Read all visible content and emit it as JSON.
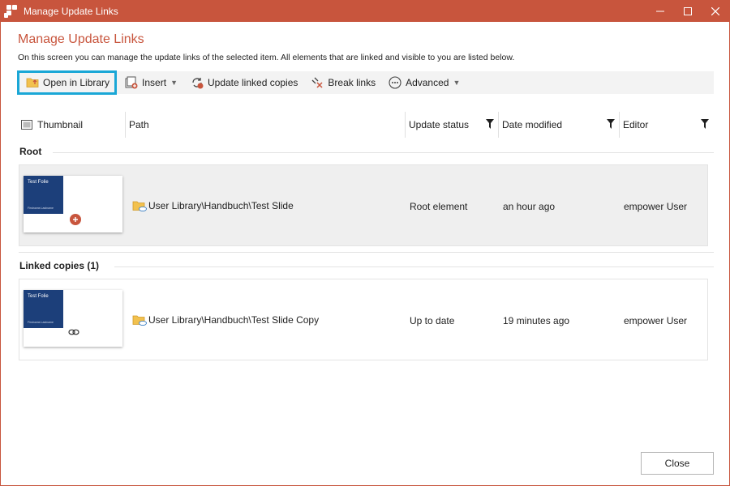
{
  "window": {
    "title": "Manage Update Links",
    "controls": {
      "minimize": "—",
      "maximize": "☐",
      "close": "✕"
    }
  },
  "header": {
    "title": "Manage Update Links",
    "description": "On this screen you can manage the update links of the selected item. All elements that are linked and visible to you are listed below."
  },
  "toolbar": {
    "open_in_library": "Open in Library",
    "insert": "Insert",
    "update_linked_copies": "Update linked copies",
    "break_links": "Break links",
    "advanced": "Advanced"
  },
  "columns": {
    "thumbnail": "Thumbnail",
    "path": "Path",
    "update_status": "Update status",
    "date_modified": "Date modified",
    "editor": "Editor"
  },
  "groups": {
    "root": {
      "title": "Root",
      "item": {
        "thumb_title": "Test Folie",
        "thumb_sub": "Firstname.Lastname",
        "path": "User Library\\Handbuch\\Test Slide",
        "status": "Root element",
        "date": "an hour ago",
        "editor": "empower User"
      }
    },
    "copies": {
      "title": "Linked copies (1)",
      "item": {
        "thumb_title": "Test Folie",
        "thumb_sub": "Firstname.Lastname",
        "path": "User Library\\Handbuch\\Test Slide Copy",
        "status": "Up to date",
        "date": "19 minutes ago",
        "editor": "empower User"
      }
    }
  },
  "footer": {
    "close_label": "Close"
  },
  "colors": {
    "accent": "#c8553d",
    "selection": "#1aa7d6",
    "thumb_blue": "#1c3f7a"
  }
}
